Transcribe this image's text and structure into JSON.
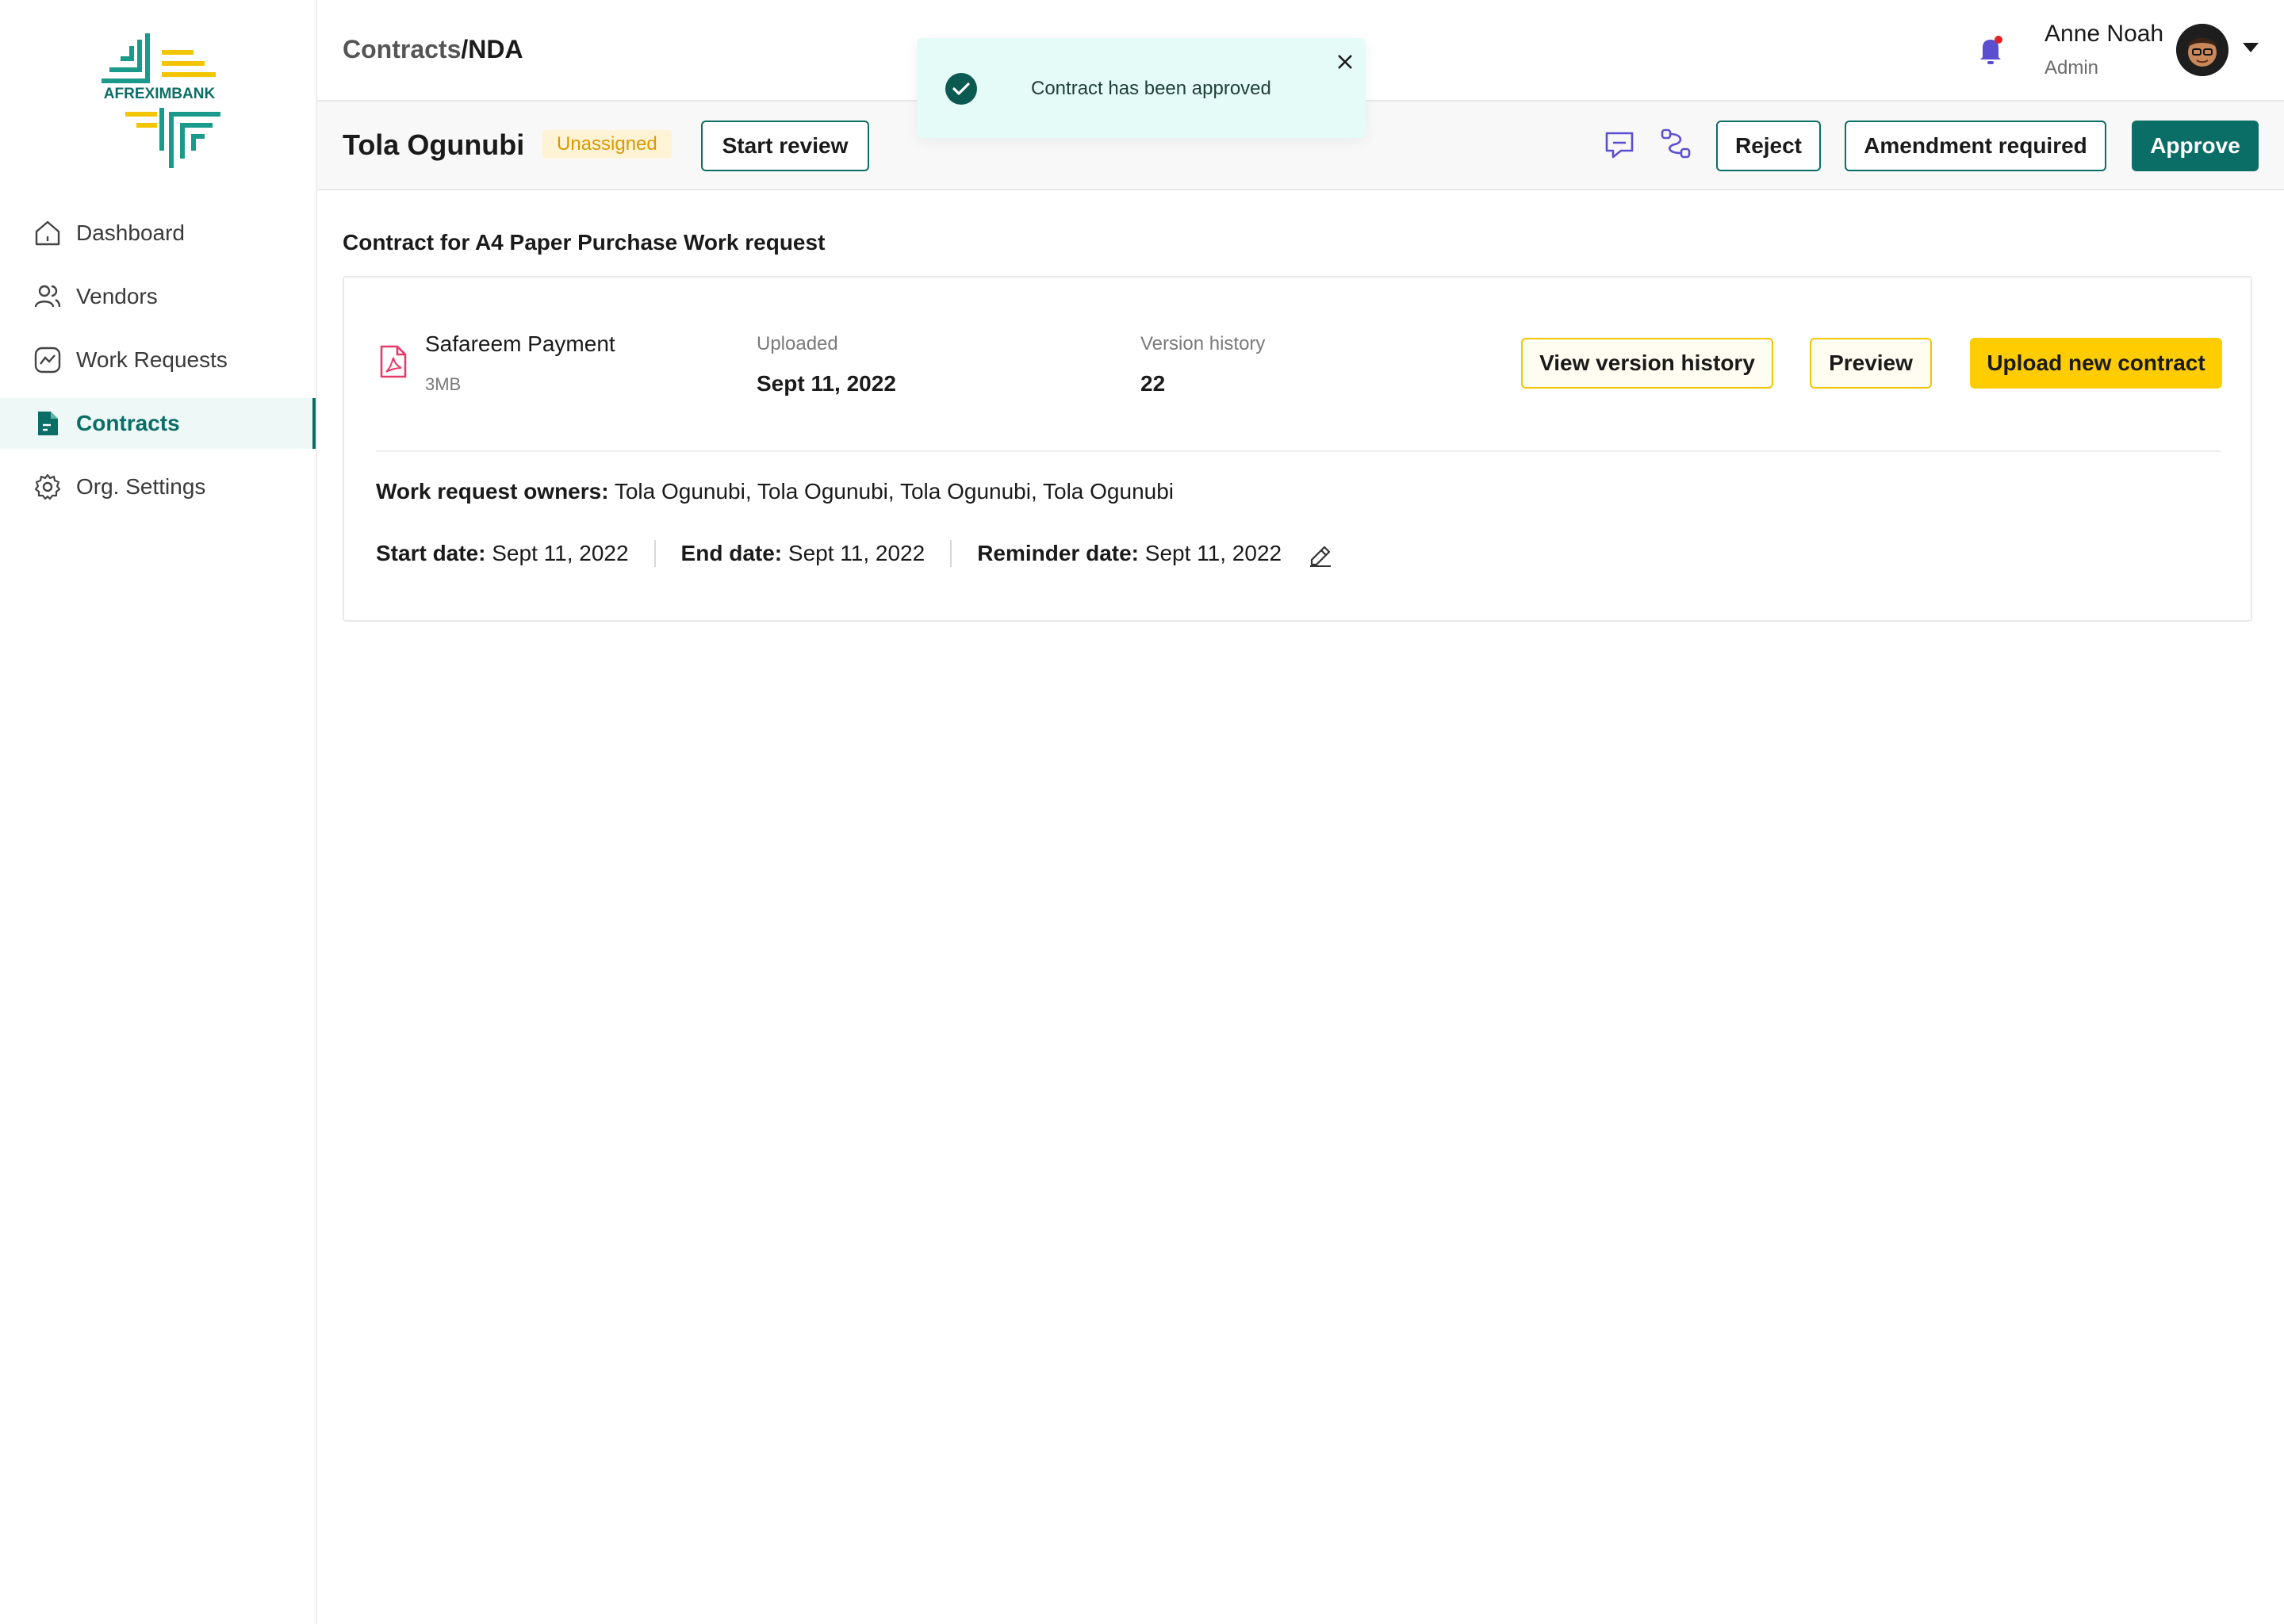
{
  "brand": {
    "name": "AFREXIMBANK",
    "primary": "#0b6e66",
    "accent": "#ffcc00"
  },
  "sidebar": {
    "items": [
      {
        "label": "Dashboard",
        "icon": "home-icon",
        "active": false
      },
      {
        "label": "Vendors",
        "icon": "users-icon",
        "active": false
      },
      {
        "label": "Work Requests",
        "icon": "chart-icon",
        "active": false
      },
      {
        "label": "Contracts",
        "icon": "document-icon",
        "active": true
      },
      {
        "label": "Org. Settings",
        "icon": "gear-icon",
        "active": false
      }
    ]
  },
  "header": {
    "breadcrumb_parent": "Contracts",
    "breadcrumb_sep": "/",
    "breadcrumb_current": "NDA",
    "user_name": "Anne Noah",
    "user_role": "Admin"
  },
  "toast": {
    "message": "Contract has been approved"
  },
  "actionbar": {
    "vendor_name": "Tola Ogunubi",
    "status_badge": "Unassigned",
    "start_review_label": "Start review",
    "reject_label": "Reject",
    "amendment_label": "Amendment required",
    "approve_label": "Approve"
  },
  "main": {
    "section_title": "Contract for A4 Paper Purchase Work request",
    "file": {
      "name": "Safareem Payment",
      "size": "3MB"
    },
    "uploaded_label": "Uploaded",
    "uploaded_value": "Sept 11, 2022",
    "version_label": "Version history",
    "version_value": "22",
    "view_version_label": "View version history",
    "preview_label": "Preview",
    "upload_label": "Upload new contract",
    "owners_label": "Work request owners:",
    "owners_value": " Tola Ogunubi, Tola Ogunubi, Tola Ogunubi, Tola Ogunubi",
    "start_label": "Start date:",
    "start_value": " Sept 11, 2022",
    "end_label": "End date:",
    "end_value": " Sept 11, 2022",
    "reminder_label": "Reminder date:",
    "reminder_value": " Sept 11, 2022"
  }
}
